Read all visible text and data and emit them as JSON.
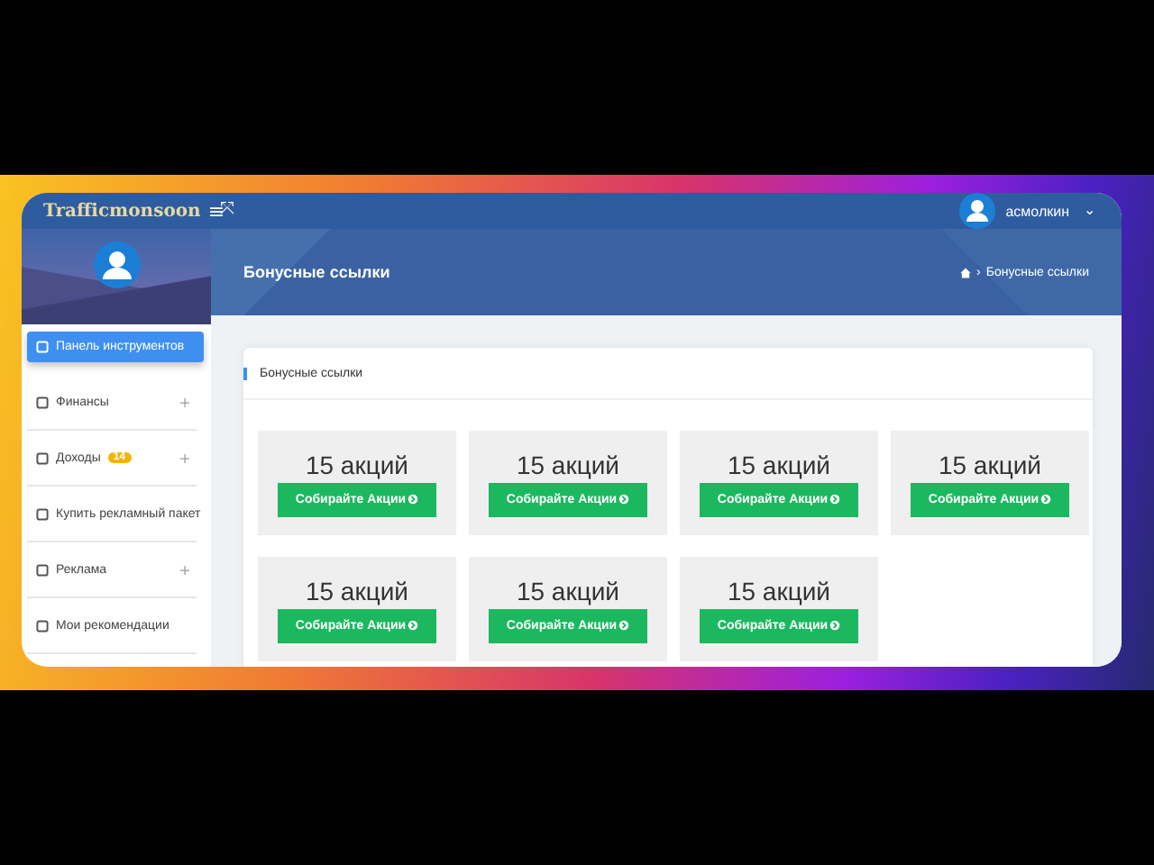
{
  "topbar": {
    "brand": "Trafficmonsoon",
    "menu_glyph": "≡",
    "expand_glyph": "⤧",
    "username": "асмолкин",
    "caret": "⌄"
  },
  "banner": {
    "title": "Бонусные ссылки",
    "breadcrumb": "Бонусные ссылки",
    "separator": "›"
  },
  "sidebar": {
    "items": [
      {
        "kind": "button",
        "label": "Панель инструментов",
        "selected": true,
        "expandable": false
      },
      {
        "kind": "link",
        "label": "Финансы",
        "selected": false,
        "expandable": true
      },
      {
        "kind": "link",
        "label": "Доходы",
        "badge": "14",
        "selected": false,
        "expandable": true
      },
      {
        "kind": "link",
        "label": "Купить рекламный пакет",
        "selected": false,
        "expandable": false
      },
      {
        "kind": "link",
        "label": "Реклама",
        "selected": false,
        "expandable": true
      },
      {
        "kind": "link",
        "label": "Мои рекомендации",
        "selected": false,
        "expandable": false
      }
    ]
  },
  "card": {
    "title": "Бонусные ссылки",
    "tiles": [
      {
        "count": "15 акций",
        "button": "Собирайте Акции"
      },
      {
        "count": "15 акций",
        "button": "Собирайте Акции"
      },
      {
        "count": "15 акций",
        "button": "Собирайте Акции"
      },
      {
        "count": "15 акций",
        "button": "Собирайте Акции"
      },
      {
        "count": "15 акций",
        "button": "Собирайте Акции"
      },
      {
        "count": "15 акций",
        "button": "Собирайте Акции"
      },
      {
        "count": "15 акций",
        "button": "Собирайте Акции"
      }
    ]
  }
}
